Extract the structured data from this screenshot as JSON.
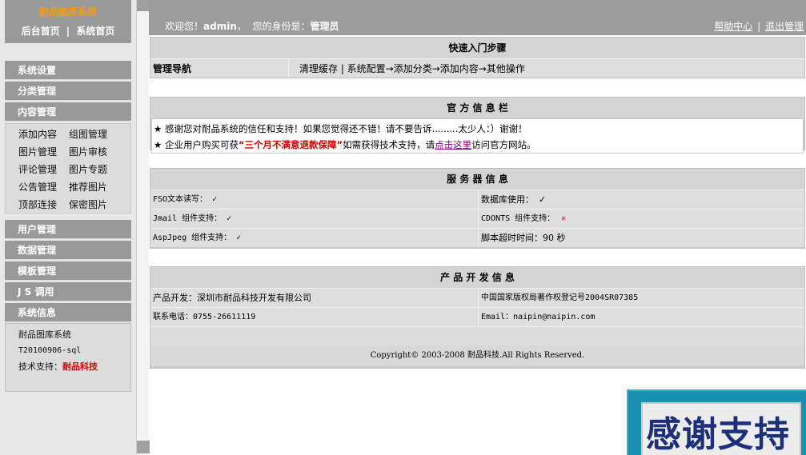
{
  "sidebar": {
    "logo_title": "耐品图库系统",
    "admin_home": "后台首页",
    "separator": "|",
    "system_home": "系统首页",
    "menu": {
      "system_settings": "系统设置",
      "category_mgmt": "分类管理",
      "content_mgmt": "内容管理",
      "user_mgmt": "用户管理",
      "data_mgmt": "数据管理",
      "template_mgmt": "模板管理",
      "js_call": "J S 调用",
      "system_info": "系统信息"
    },
    "content_items": [
      "添加内容",
      "组图管理",
      "图片管理",
      "图片审核",
      "评论管理",
      "图片专题",
      "公告管理",
      "推荐图片",
      "顶部连接",
      "保密图片"
    ],
    "sysinfo": {
      "name": "耐品图库系统",
      "version": "T20100906-sql",
      "support_label": "技术支持：",
      "support_name": "耐品科技"
    }
  },
  "topbar": {
    "welcome_prefix": "欢迎您！",
    "username": "admin",
    "identity_label": "，  您的身份是：",
    "role": "管理员",
    "help_center": "帮助中心",
    "link_separator": "|",
    "logout": "退出管理"
  },
  "quick_start": {
    "title": "快速入门步骤",
    "nav_label": "管理导航",
    "nav_content": "清理缓存 | 系统配置→添加分类→添加内容→其他操作"
  },
  "notice": {
    "title": "官 方 信 息 栏",
    "line1": "★ 感谢您对耐品系统的信任和支持！如果您觉得还不错！请不要告诉.........太少人：）谢谢！",
    "line2_prefix": "★ 企业用户购买可获",
    "line2_highlight": "“三个月不满意退款保障”",
    "line2_middle": "如需获得技术支持，请",
    "line2_link": "点击这里",
    "line2_suffix": "访问官方网站。"
  },
  "server": {
    "title": "服 务 器 信 息",
    "fso_label": "FSO文本读写：",
    "fso_status": "✓",
    "db_label": "数据库使用：",
    "db_status": "✓",
    "jmail_label": "Jmail 组件支持：",
    "jmail_status": "✓",
    "cdonts_label": "CDONTS 组件支持：",
    "cdonts_status": "✕",
    "aspjpeg_label": "AspJpeg 组件支持：",
    "aspjpeg_status": "✓",
    "timeout_label": "脚本超时时间：90 秒"
  },
  "product": {
    "title": "产 品 开 发 信 息",
    "developer": "产品开发：深圳市耐品科技开发有限公司",
    "copyright_reg": "中国国家版权局著作权登记号2004SR07385",
    "phone": "联系电话：0755-26611119",
    "email": "Email：naipin@naipin.com",
    "footer": "Copyright© 2003-2008 耐品科技.All Rights Reserved."
  },
  "badge": {
    "text": "感谢支持"
  },
  "colors": {
    "menu_gray": "#999999",
    "logo_orange": "#ff9c00",
    "highlight_red": "#cc0000",
    "badge_blue": "#1a8fb0",
    "badge_text": "#1c2f78"
  }
}
